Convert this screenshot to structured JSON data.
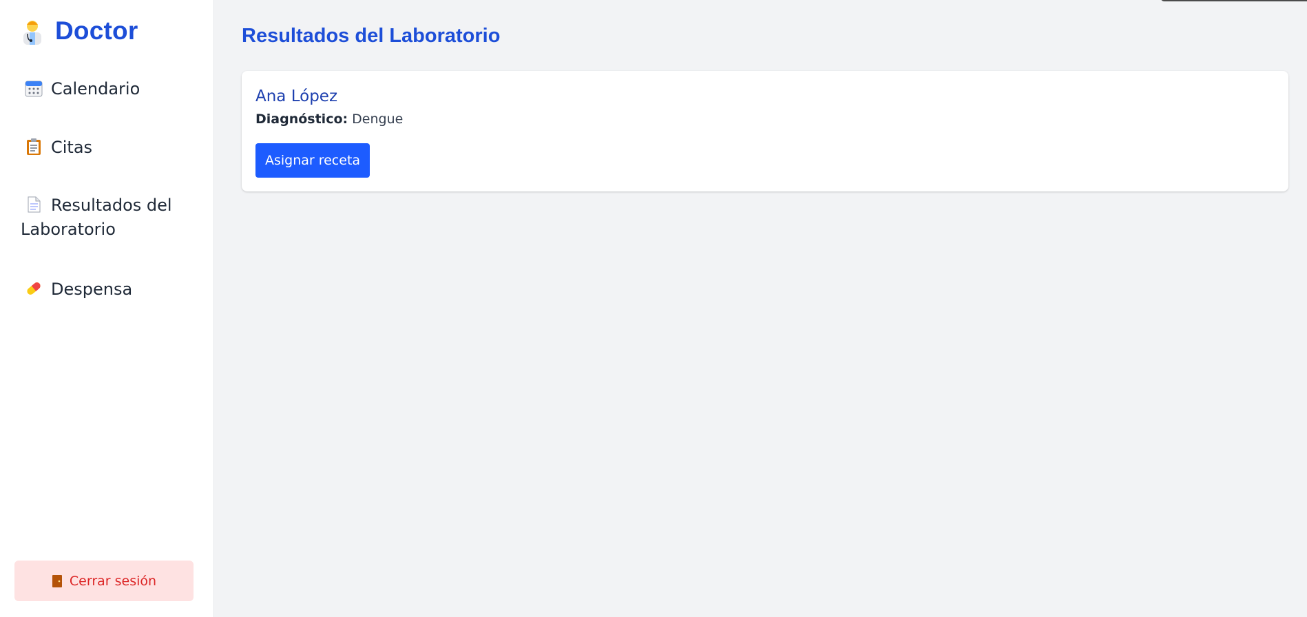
{
  "sidebar": {
    "brand": {
      "icon": "doctor-icon",
      "title": "Doctor"
    },
    "items": [
      {
        "icon": "calendar-icon",
        "label": "Calendario"
      },
      {
        "icon": "clipboard-icon",
        "label": "Citas"
      },
      {
        "icon": "document-icon",
        "label_line1": "Resultados del",
        "label_line2": "Laboratorio"
      },
      {
        "icon": "pill-icon",
        "label": "Despensa"
      }
    ],
    "logout": {
      "icon": "door-icon",
      "label": "Cerrar sesión"
    }
  },
  "main": {
    "title": "Resultados del Laboratorio",
    "results": [
      {
        "patient": "Ana López",
        "diagnosis_label": "Diagnóstico:",
        "diagnosis_value": "Dengue",
        "action_label": "Asignar receta"
      }
    ]
  },
  "colors": {
    "accent": "#1d4ed8",
    "button": "#1d5cff",
    "logout_bg": "#fee2e2",
    "logout_text": "#dc2626",
    "background": "#f2f3f5"
  }
}
